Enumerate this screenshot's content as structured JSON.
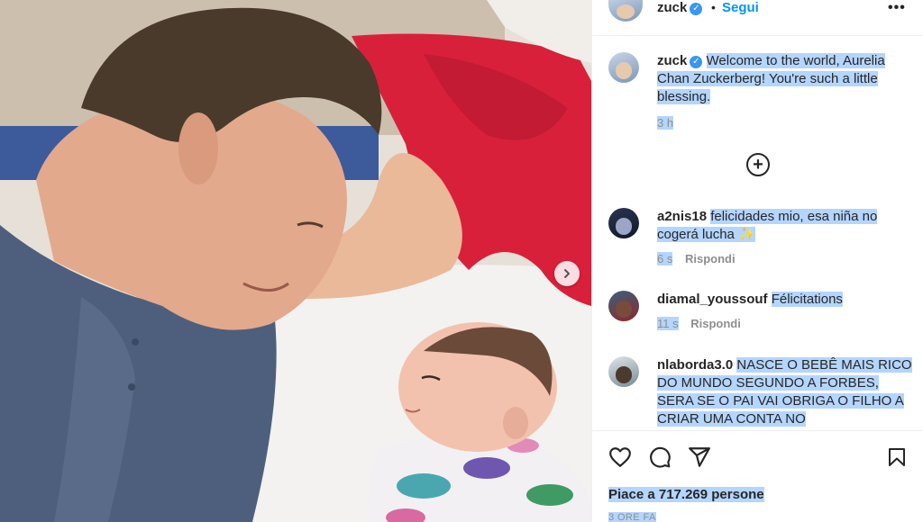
{
  "post": {
    "author": "zuck",
    "follow_label": "Segui",
    "separator": "•",
    "more_label": "•••"
  },
  "caption": {
    "username": "zuck",
    "text": "Welcome to the world, Aurelia Chan Zuckerberg! You're such a little blessing.",
    "time": "3 h"
  },
  "load_more_label": "+",
  "comments": [
    {
      "username": "a2nis18",
      "text": "felicidades mio, esa niña no cogerá lucha ✨",
      "time": "6 s",
      "reply": "Rispondi"
    },
    {
      "username": "diamal_youssouf",
      "text": "Félicitations",
      "time": "11 s",
      "reply": "Rispondi"
    },
    {
      "username": "nlaborda3.0",
      "text": "NASCE O BEBÊ MAIS RICO DO MUNDO SEGUNDO A FORBES, SERA SE O PAI VAI OBRIGA O FILHO A CRIAR UMA CONTA NO"
    }
  ],
  "footer": {
    "likes": "Piace a 717.269 persone",
    "timestamp": "3 ORE FA"
  },
  "icons": {
    "like": "heart-icon",
    "comment": "comment-icon",
    "share": "share-icon",
    "save": "bookmark-icon",
    "next": "chevron-right-icon",
    "verified": "verified-badge-icon"
  },
  "colors": {
    "link_blue": "#0095f6",
    "selection": "#b4d5fe",
    "verified": "#3897f0",
    "muted": "#8e8e8e"
  }
}
